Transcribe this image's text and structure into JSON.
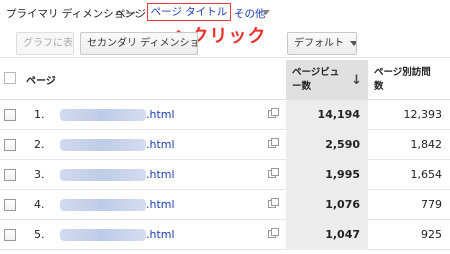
{
  "dimension_bar": {
    "label": "プライマリ ディメンション:",
    "page": "ページ",
    "page_title": "ページ タイトル",
    "other": "その他"
  },
  "annotation": {
    "arrow": "↑",
    "text": "クリック"
  },
  "toolbar": {
    "chart_button": "グラフに表示",
    "secondary_dimension": "セカンダリ ディメンション",
    "sort_type": "デフォルト"
  },
  "table": {
    "headers": {
      "page": "ページ",
      "pageviews": "ページビュー数",
      "unique_pageviews": "ページ別訪問数"
    },
    "rows": [
      {
        "num": "1.",
        "link": ".html",
        "pageviews": "14,194",
        "unique": "12,393"
      },
      {
        "num": "2.",
        "link": ".html",
        "pageviews": "2,590",
        "unique": "1,842"
      },
      {
        "num": "3.",
        "link": ".html",
        "pageviews": "1,995",
        "unique": "1,654"
      },
      {
        "num": "4.",
        "link": ".html",
        "pageviews": "1,076",
        "unique": "779"
      },
      {
        "num": "5.",
        "link": ".html",
        "pageviews": "1,047",
        "unique": "925"
      }
    ]
  },
  "colors": {
    "link": "#1a3fb2",
    "annotation": "#e8322e"
  }
}
